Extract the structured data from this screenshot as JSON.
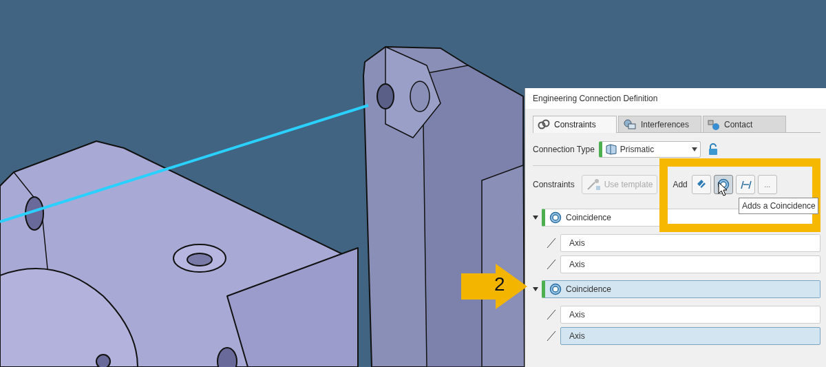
{
  "dialog": {
    "title": "Engineering Connection Definition",
    "tabs": [
      {
        "label": "Constraints",
        "kind": "constraints",
        "selected": true
      },
      {
        "label": "Interferences",
        "kind": "interferences",
        "selected": false
      },
      {
        "label": "Contact",
        "kind": "contact",
        "selected": false
      }
    ],
    "connection_type": {
      "label": "Connection Type",
      "value": "Prismatic"
    },
    "constraints_toolbar": {
      "label": "Constraints",
      "template_button": {
        "label": "Use template",
        "disabled": true
      },
      "add_label": "Add",
      "add_buttons": [
        {
          "kind": "contact",
          "pressed": false
        },
        {
          "kind": "coincidence",
          "pressed": true
        },
        {
          "kind": "offset",
          "pressed": false
        },
        {
          "kind": "more",
          "label": "..."
        }
      ]
    },
    "tooltip": "Adds a Coincidence",
    "constraints": [
      {
        "name": "Coincidence",
        "expanded": true,
        "selected": false,
        "children": [
          {
            "name": "Axis",
            "selected": false
          },
          {
            "name": "Axis",
            "selected": false
          }
        ]
      },
      {
        "name": "Coincidence",
        "expanded": true,
        "selected": true,
        "children": [
          {
            "name": "Axis",
            "selected": false
          },
          {
            "name": "Axis",
            "selected": true
          }
        ]
      }
    ]
  },
  "step_marker": "2"
}
